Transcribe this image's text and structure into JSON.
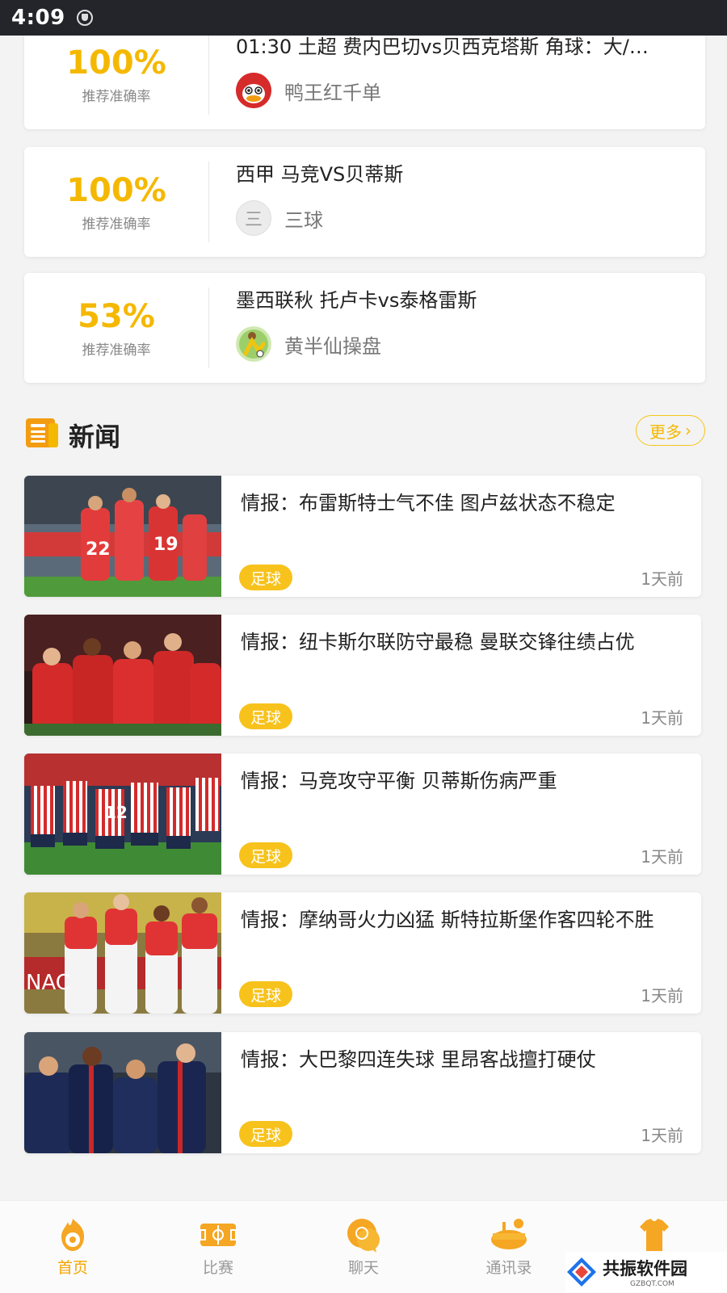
{
  "status_bar": {
    "time": "4:09"
  },
  "recommendations": [
    {
      "accuracy": "100%",
      "accuracy_label": "推荐准确率",
      "title": "01:30 土超 费内巴切vs贝西克塔斯 角球：大/…",
      "expert": "鸭王红千单",
      "avatar": "duck-avatar"
    },
    {
      "accuracy": "100%",
      "accuracy_label": "推荐准确率",
      "title": "西甲 马竞VS贝蒂斯",
      "expert": "三球",
      "avatar": "text-avatar",
      "avatar_text": "三"
    },
    {
      "accuracy": "53%",
      "accuracy_label": "推荐准确率",
      "title": "墨西联秋 托卢卡vs泰格雷斯",
      "expert": "黄半仙操盘",
      "avatar": "player-avatar"
    }
  ],
  "news_section": {
    "title": "新闻",
    "more_label": "更多"
  },
  "news": [
    {
      "title": "情报：布雷斯特士气不佳 图卢兹状态不稳定",
      "tag": "足球",
      "time": "1天前",
      "thumb": "red-kit-players-photo"
    },
    {
      "title": "情报：纽卡斯尔联防守最稳 曼联交锋往绩占优",
      "tag": "足球",
      "time": "1天前",
      "thumb": "red-kit-players-photo"
    },
    {
      "title": "情报：马竞攻守平衡 贝蒂斯伤病严重",
      "tag": "足球",
      "time": "1天前",
      "thumb": "striped-kit-players-photo"
    },
    {
      "title": "情报：摩纳哥火力凶猛 斯特拉斯堡作客四轮不胜",
      "tag": "足球",
      "time": "1天前",
      "thumb": "red-white-kit-players-photo"
    },
    {
      "title": "情报：大巴黎四连失球 里昂客战擅打硬仗",
      "tag": "足球",
      "time": "1天前",
      "thumb": "navy-kit-players-photo"
    }
  ],
  "tabbar": [
    {
      "label": "首页",
      "icon": "home-icon",
      "active": true
    },
    {
      "label": "比赛",
      "icon": "match-icon",
      "active": false
    },
    {
      "label": "聊天",
      "icon": "chat-icon",
      "active": false
    },
    {
      "label": "通讯录",
      "icon": "contacts-icon",
      "active": false
    },
    {
      "label": "",
      "icon": "profile-jersey-icon",
      "active": false
    }
  ],
  "watermark": {
    "text": "共振软件园",
    "sub": "GZBQT.COM"
  },
  "colors": {
    "accent": "#f5b800",
    "tag": "#f7c21b",
    "status_bar": "#23252b"
  }
}
